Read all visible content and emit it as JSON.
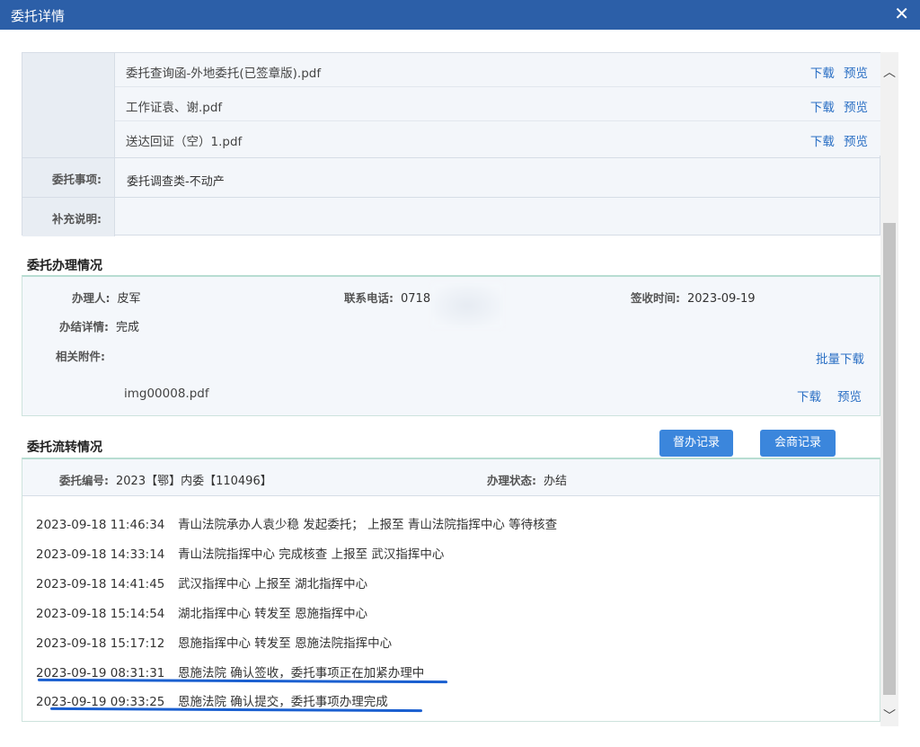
{
  "window": {
    "title": "委托详情",
    "close_icon": "close-icon"
  },
  "attachments": [
    {
      "name": "委托查询函-外地委托(已签章版).pdf",
      "download": "下载",
      "preview": "预览"
    },
    {
      "name": "工作证袁、谢.pdf",
      "download": "下载",
      "preview": "预览"
    },
    {
      "name": "送达回证（空）1.pdf",
      "download": "下载",
      "preview": "预览"
    }
  ],
  "matter": {
    "label": "委托事项:",
    "value": "委托调查类-不动产"
  },
  "supplement": {
    "label": "补充说明:",
    "value": ""
  },
  "handling": {
    "section_title": "委托办理情况",
    "handler_label": "办理人:",
    "handler": "皮军",
    "phone_label": "联系电话:",
    "phone": "0718",
    "sign_label": "签收时间:",
    "sign_time": "2023-09-19",
    "detail_label": "办结详情:",
    "detail": "完成",
    "attach_label": "相关附件:",
    "batch_download": "批量下载",
    "file": "img00008.pdf",
    "download": "下载",
    "preview": "预览"
  },
  "flow": {
    "section_title": "委托流转情况",
    "btn_supervise": "督办记录",
    "btn_consult": "会商记录",
    "number_label": "委托编号:",
    "number": "2023【鄂】内委【110496】",
    "status_label": "办理状态:",
    "status": "办结",
    "logs": [
      {
        "time": "2023-09-18 11:46:34",
        "text": "青山法院承办人袁少稳  发起委托；  上报至  青山法院指挥中心  等待核查"
      },
      {
        "time": "2023-09-18 14:33:14",
        "text": "青山法院指挥中心  完成核查  上报至  武汉指挥中心"
      },
      {
        "time": "2023-09-18 14:41:45",
        "text": "武汉指挥中心  上报至  湖北指挥中心"
      },
      {
        "time": "2023-09-18 15:14:54",
        "text": "湖北指挥中心  转发至  恩施指挥中心"
      },
      {
        "time": "2023-09-18 15:17:12",
        "text": "恩施指挥中心  转发至  恩施法院指挥中心"
      },
      {
        "time": "2023-09-19 08:31:31",
        "text": "恩施法院  确认签收，委托事项正在加紧办理中"
      },
      {
        "time": "2023-09-19 09:33:25",
        "text": "恩施法院  确认提交，委托事项办理完成"
      }
    ]
  },
  "colors": {
    "titlebar": "#2c5fa8",
    "link": "#2a6fc4",
    "button": "#3b86dc",
    "underline": "#1a5fd0"
  }
}
